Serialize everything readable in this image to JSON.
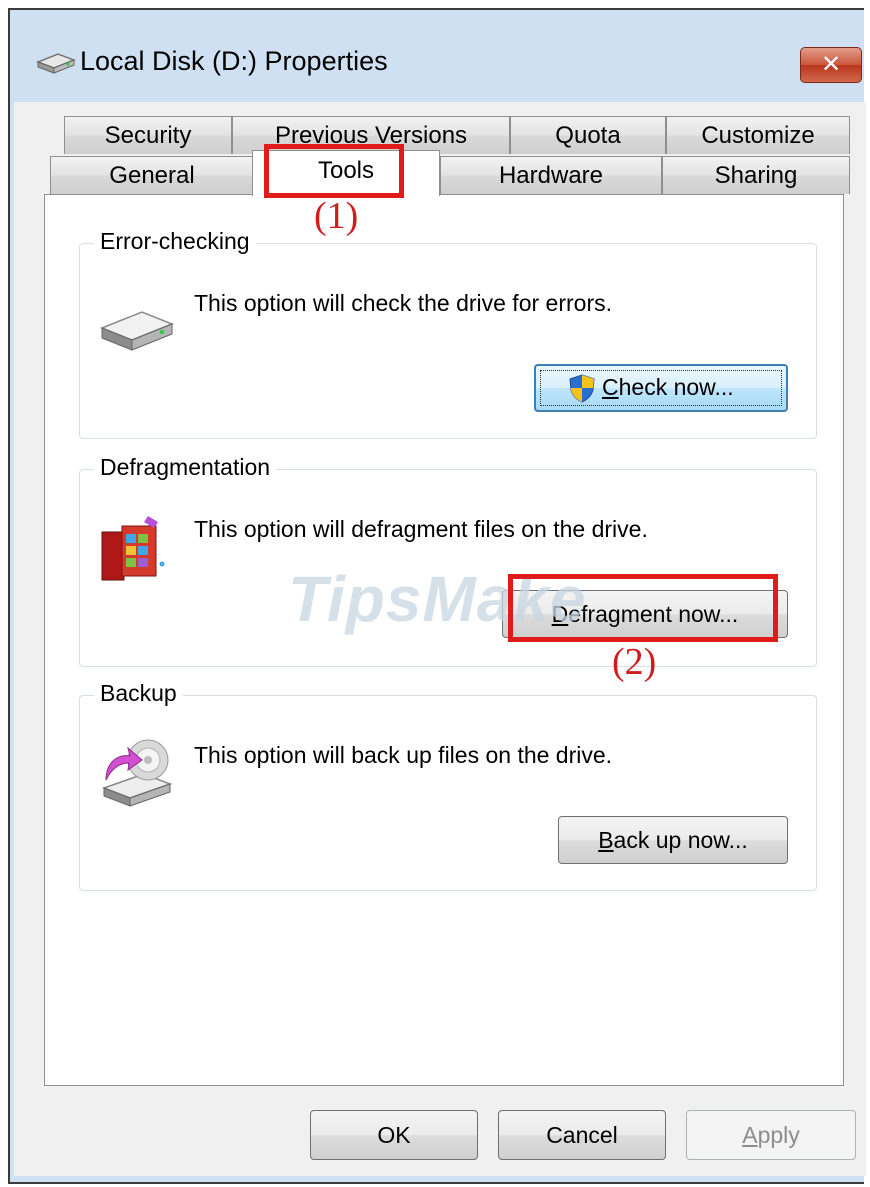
{
  "window": {
    "title": "Local Disk (D:) Properties",
    "close_glyph": "✕"
  },
  "tabs": {
    "row1": [
      "Security",
      "Previous Versions",
      "Quota",
      "Customize"
    ],
    "row2": [
      "General",
      "Tools",
      "Hardware",
      "Sharing"
    ],
    "active": "Tools"
  },
  "groups": {
    "error_checking": {
      "label": "Error-checking",
      "text": "This option will check the drive for errors.",
      "button_accel": "C",
      "button_rest": "heck now...",
      "icon": "hard-drive-icon"
    },
    "defragmentation": {
      "label": "Defragmentation",
      "text": "This option will defragment files on the drive.",
      "button_accel": "D",
      "button_rest": "efragment now...",
      "icon": "defrag-icon"
    },
    "backup": {
      "label": "Backup",
      "text": "This option will back up files on the drive.",
      "button_accel": "B",
      "button_rest": "ack up now...",
      "icon": "backup-icon"
    }
  },
  "footer": {
    "ok": "OK",
    "cancel": "Cancel",
    "apply_accel": "A",
    "apply_rest": "pply"
  },
  "annotations": {
    "step1": "(1)",
    "step2": "(2)",
    "color": "#e01b1b"
  },
  "watermark": "TipsMake"
}
